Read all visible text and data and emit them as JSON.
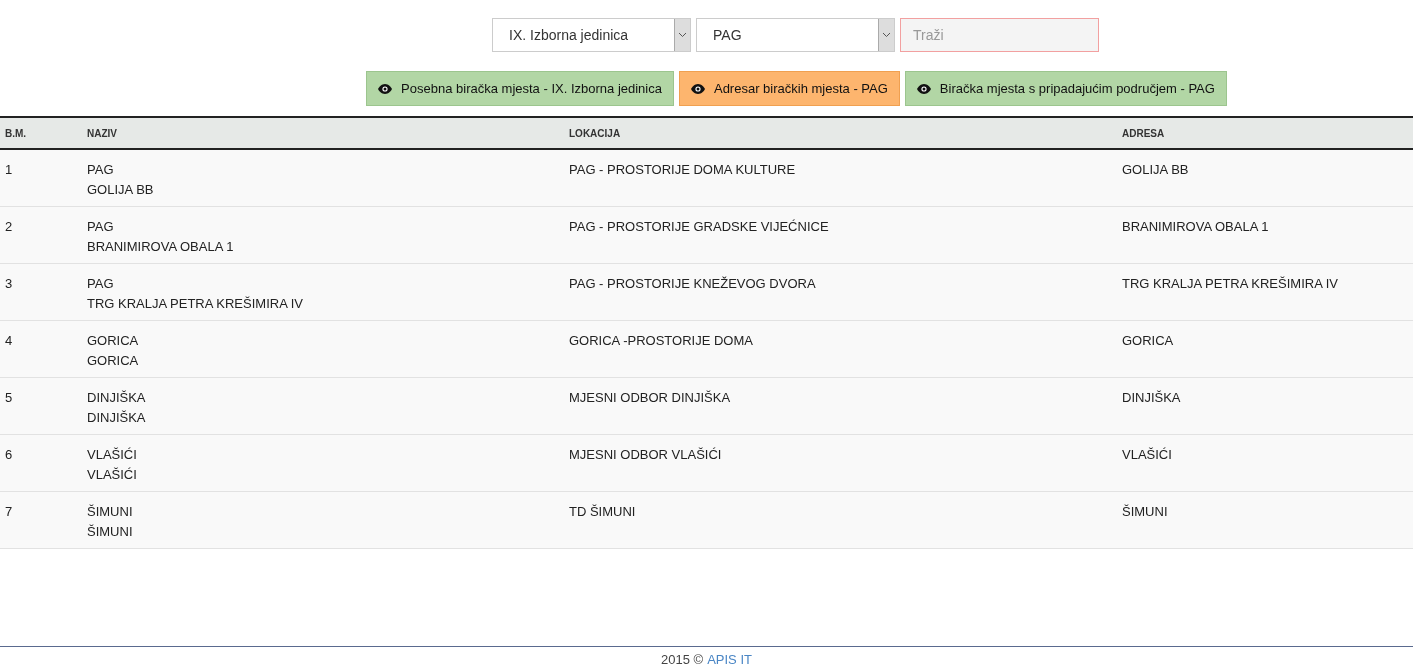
{
  "filters": {
    "unit_select": {
      "value": "IX. Izborna jedinica"
    },
    "place_select": {
      "value": "PAG"
    },
    "search": {
      "placeholder": "Traži"
    }
  },
  "buttons": [
    {
      "label": "Posebna biračka mjesta - IX. Izborna jedinica",
      "selected": false
    },
    {
      "label": "Adresar biračkih mjesta - PAG",
      "selected": true
    },
    {
      "label": "Biračka mjesta s pripadajućim područjem - PAG",
      "selected": false
    }
  ],
  "table": {
    "columns": [
      "B.M.",
      "NAZIV",
      "LOKACIJA",
      "ADRESA"
    ],
    "rows": [
      {
        "number": "1",
        "name": "PAG",
        "name_address": "GOLIJA BB",
        "location": "PAG - PROSTORIJE DOMA KULTURE",
        "address": "GOLIJA BB"
      },
      {
        "number": "2",
        "name": "PAG",
        "name_address": "BRANIMIROVA OBALA 1",
        "location": "PAG - PROSTORIJE GRADSKE VIJEĆNICE",
        "address": "BRANIMIROVA OBALA 1"
      },
      {
        "number": "3",
        "name": "PAG",
        "name_address": "TRG KRALJA PETRA KREŠIMIRA IV",
        "location": "PAG - PROSTORIJE KNEŽEVOG DVORA",
        "address": "TRG KRALJA PETRA KREŠIMIRA IV"
      },
      {
        "number": "4",
        "name": "GORICA",
        "name_address": "GORICA",
        "location": "GORICA -PROSTORIJE DOMA",
        "address": "GORICA"
      },
      {
        "number": "5",
        "name": "DINJIŠKA",
        "name_address": "DINJIŠKA",
        "location": "MJESNI ODBOR DINJIŠKA",
        "address": "DINJIŠKA"
      },
      {
        "number": "6",
        "name": "VLAŠIĆI",
        "name_address": "VLAŠIĆI",
        "location": "MJESNI ODBOR VLAŠIĆI",
        "address": "VLAŠIĆI"
      },
      {
        "number": "7",
        "name": "ŠIMUNI",
        "name_address": "ŠIMUNI",
        "location": "TD ŠIMUNI",
        "address": "ŠIMUNI"
      }
    ]
  },
  "footer": {
    "text": "2015 ©",
    "link": "APIS IT"
  }
}
